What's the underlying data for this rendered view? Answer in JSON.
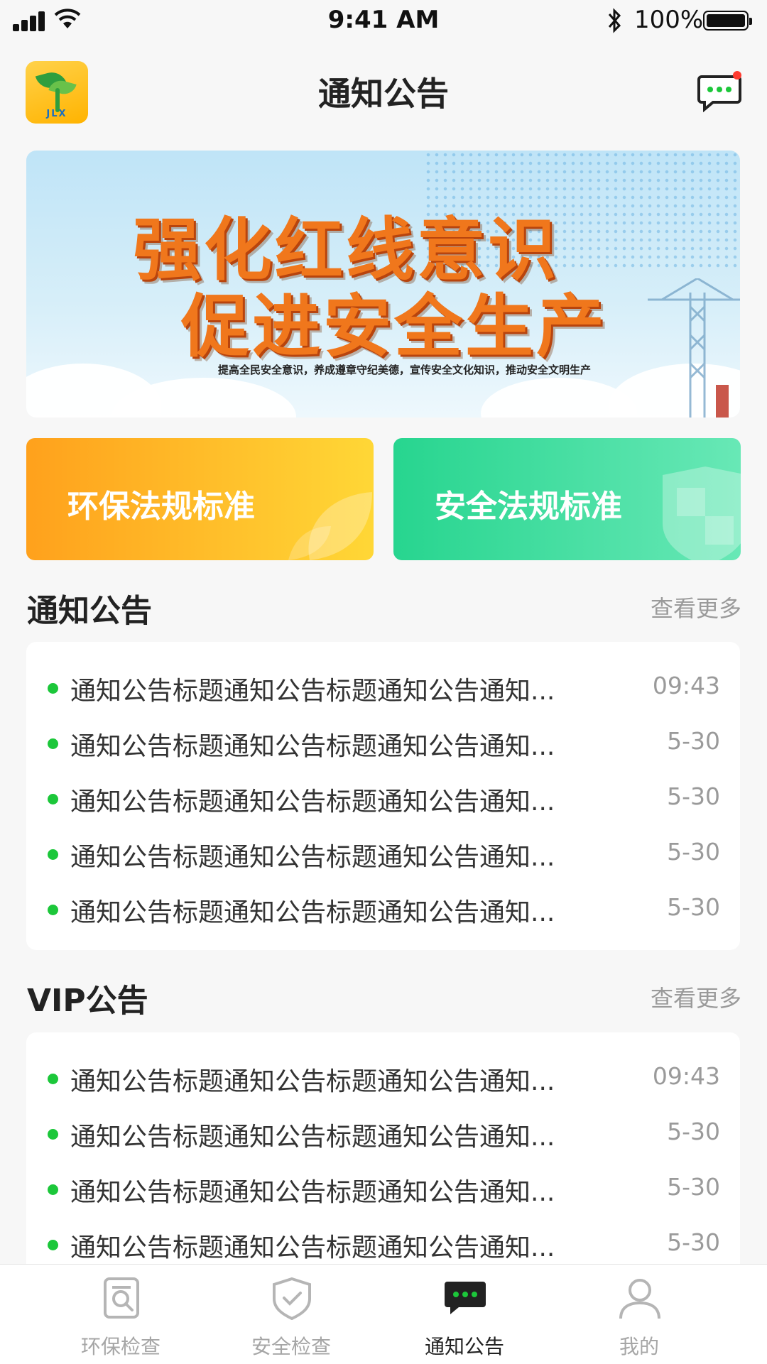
{
  "status_bar": {
    "time": "9:41 AM",
    "battery_text": "100%",
    "battery_level_percent": 100
  },
  "header": {
    "title": "通知公告",
    "logo_text": "JLX",
    "logo_icon": "app-logo",
    "message_icon": "chat-bubble-icon"
  },
  "banner": {
    "line1": "强化红线意识",
    "line2": "促进安全生产",
    "subtitle": "提高全民安全意识，养成遵章守纪美德，宣传安全文化知识，推动安全文明生产"
  },
  "categories": [
    {
      "label": "环保法规标准",
      "icon": "leaf-icon"
    },
    {
      "label": "安全法规标准",
      "icon": "shield-icon"
    }
  ],
  "notices": {
    "title": "通知公告",
    "more": "查看更多",
    "items": [
      {
        "title": "通知公告标题通知公告标题通知公告通知...",
        "time": "09:43"
      },
      {
        "title": "通知公告标题通知公告标题通知公告通知...",
        "time": "5-30"
      },
      {
        "title": "通知公告标题通知公告标题通知公告通知...",
        "time": "5-30"
      },
      {
        "title": "通知公告标题通知公告标题通知公告通知...",
        "time": "5-30"
      },
      {
        "title": "通知公告标题通知公告标题通知公告通知...",
        "time": "5-30"
      }
    ]
  },
  "vip": {
    "title": "VIP公告",
    "more": "查看更多",
    "items": [
      {
        "title": "通知公告标题通知公告标题通知公告通知...",
        "time": "09:43"
      },
      {
        "title": "通知公告标题通知公告标题通知公告通知...",
        "time": "5-30"
      },
      {
        "title": "通知公告标题通知公告标题通知公告通知...",
        "time": "5-30"
      },
      {
        "title": "通知公告标题通知公告标题通知公告通知...",
        "time": "5-30"
      }
    ]
  },
  "tabbar": {
    "items": [
      {
        "label": "环保检查",
        "icon": "search-document-icon",
        "active": false
      },
      {
        "label": "安全检查",
        "icon": "shield-check-icon",
        "active": false
      },
      {
        "label": "通知公告",
        "icon": "chat-bubble-icon",
        "active": true
      },
      {
        "label": "我的",
        "icon": "user-icon",
        "active": false
      }
    ]
  },
  "colors": {
    "accent_green": "#1cc73a",
    "env_card": "#ffa11c",
    "safe_card": "#27d58f",
    "unread_badge": "#ff3b30"
  }
}
